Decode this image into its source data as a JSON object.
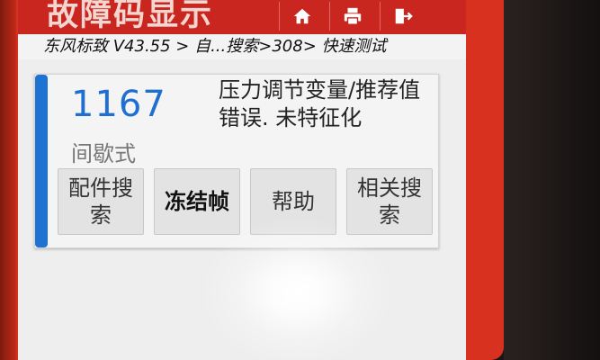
{
  "header": {
    "title": "故障码显示",
    "icons": [
      "home-icon",
      "print-icon",
      "exit-icon"
    ]
  },
  "breadcrumb": "东风标致 V43.55 > 自...搜索>308> 快速测试",
  "fault": {
    "code": "1167",
    "type": "间歇式",
    "description": "压力调节变量/推荐值错误. 未特征化"
  },
  "actions": {
    "parts_search": "配件搜索",
    "freeze_frame": "冻结帧",
    "help": "帮助",
    "related_search": "相关搜索"
  },
  "colors": {
    "header": "#c8261f",
    "accent": "#1e73d2",
    "device": "#d9311f"
  }
}
